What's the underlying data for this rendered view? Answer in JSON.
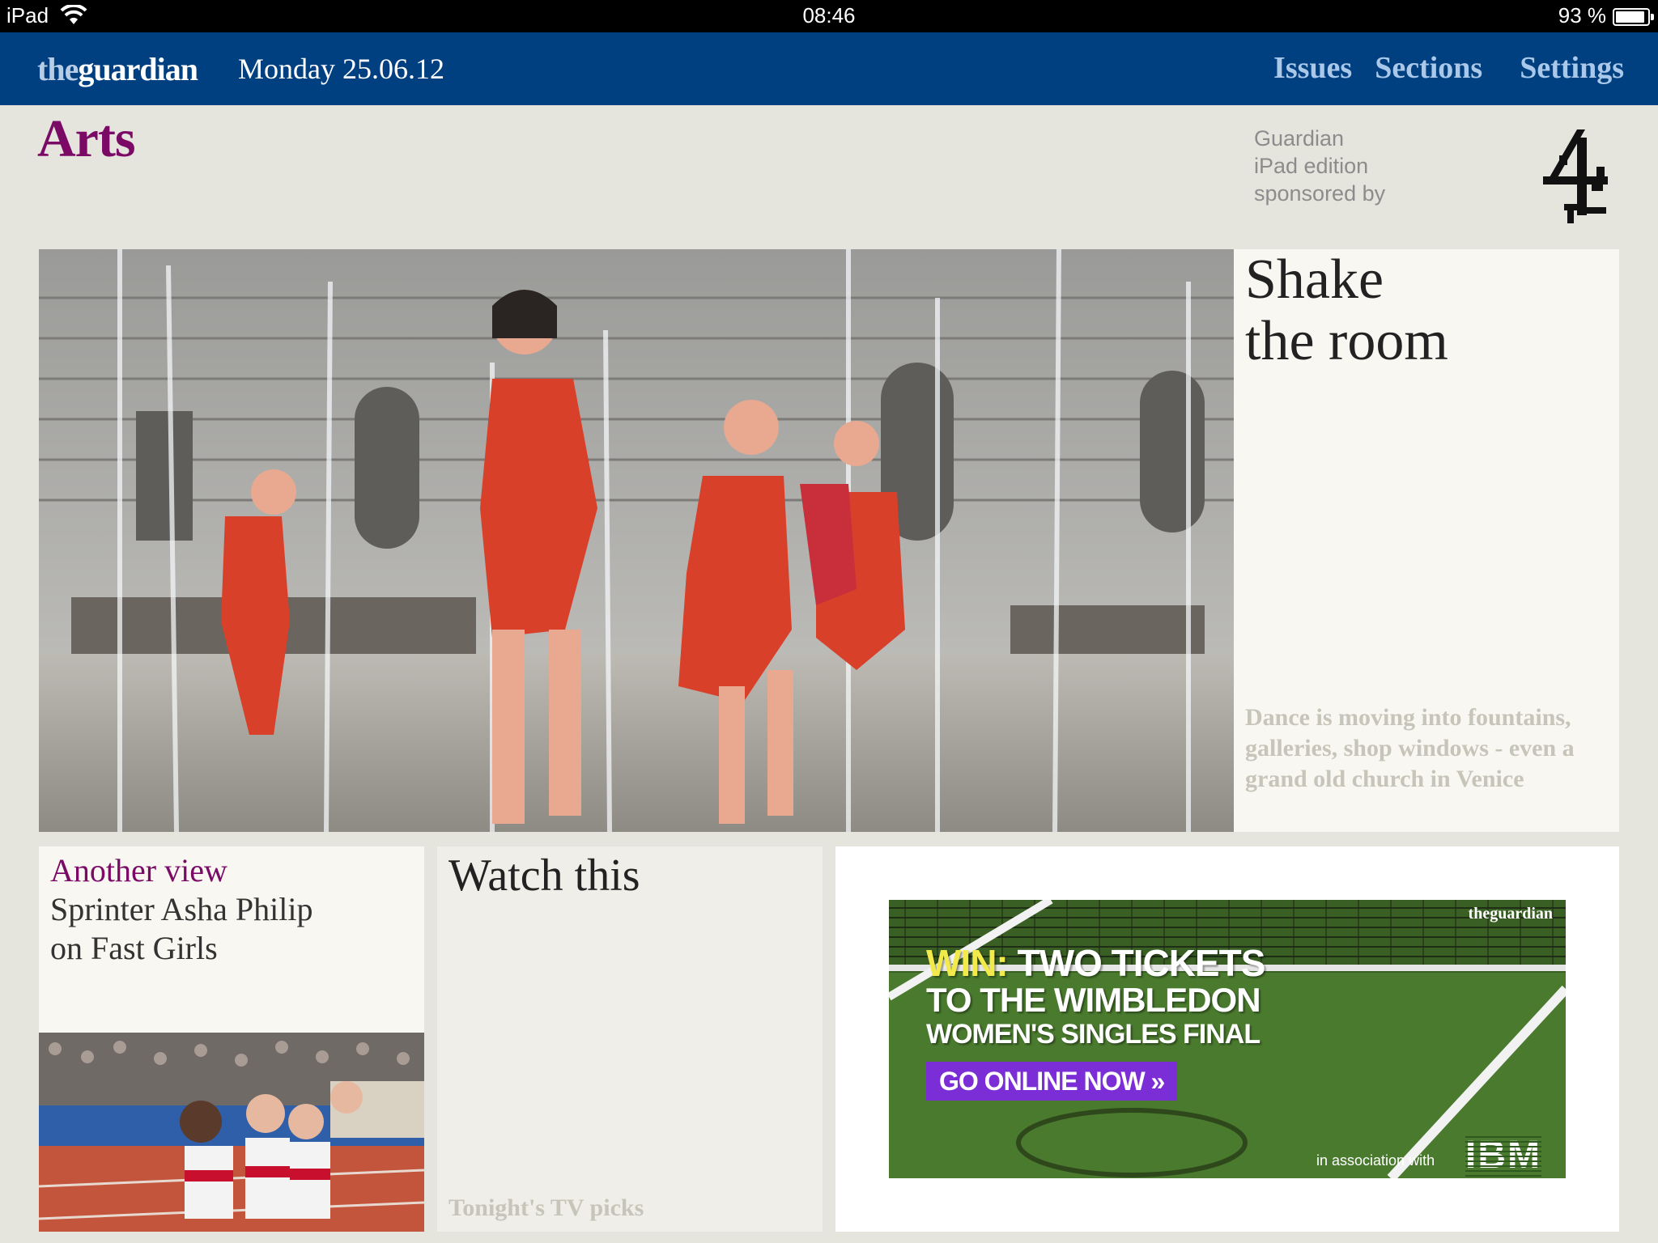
{
  "status_bar": {
    "device": "iPad",
    "time": "08:46",
    "battery_percent": "93 %",
    "battery_level": 0.93
  },
  "header": {
    "brand_the": "the",
    "brand_guardian": "guardian",
    "date": "Monday 25.06.12",
    "nav": {
      "issues": "Issues",
      "sections": "Sections",
      "settings": "Settings"
    }
  },
  "section": {
    "title": "Arts",
    "sponsor_lines": [
      "Guardian",
      "iPad edition",
      "sponsored by"
    ],
    "sponsor_logo": "channel-4-logo"
  },
  "feature": {
    "headline_lines": [
      "Shake",
      "the room"
    ],
    "standfirst": "Dance is moving into fountains, galleries, shop windows - even a grand old church in Venice"
  },
  "another_view": {
    "kicker": "Another view",
    "subline_lines": [
      "Sprinter Asha Philip",
      "on Fast Girls"
    ]
  },
  "watch_this": {
    "title": "Watch this",
    "subtitle": "Tonight's TV picks"
  },
  "ad": {
    "brand": "theguardian",
    "win": "WIN:",
    "line1_rest": " TWO TICKETS",
    "line2": "TO THE WIMBLEDON",
    "line3": "WOMEN'S SINGLES FINAL",
    "cta": "GO ONLINE NOW »",
    "association": "in association with",
    "partner": "IBM"
  },
  "colors": {
    "nav_bg": "#004080",
    "arts_accent": "#7b0a67",
    "page_bg": "#e5e4dd",
    "cta_purple": "#7b2ed6"
  }
}
